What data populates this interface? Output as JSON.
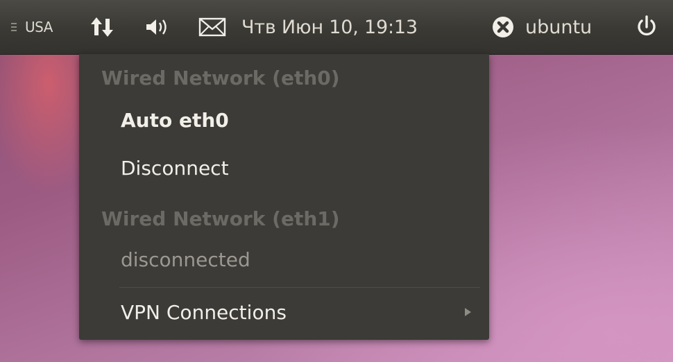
{
  "panel": {
    "keyboard_layout": "USA",
    "clock": "Чтв Июн 10, 19:13",
    "user_name": "ubuntu",
    "icons": {
      "network": "network-up-down-icon",
      "volume": "speaker-volume-icon",
      "mail": "mail-envelope-icon",
      "user": "user-status-icon",
      "power": "power-icon"
    }
  },
  "network_menu": {
    "sections": [
      {
        "header": "Wired Network (eth0)",
        "items": [
          {
            "label": "Auto eth0",
            "active": true
          },
          {
            "label": "Disconnect",
            "active": false
          }
        ]
      },
      {
        "header": "Wired Network (eth1)",
        "items": [
          {
            "label": "disconnected",
            "enabled": false
          }
        ]
      }
    ],
    "vpn_label": "VPN Connections"
  }
}
